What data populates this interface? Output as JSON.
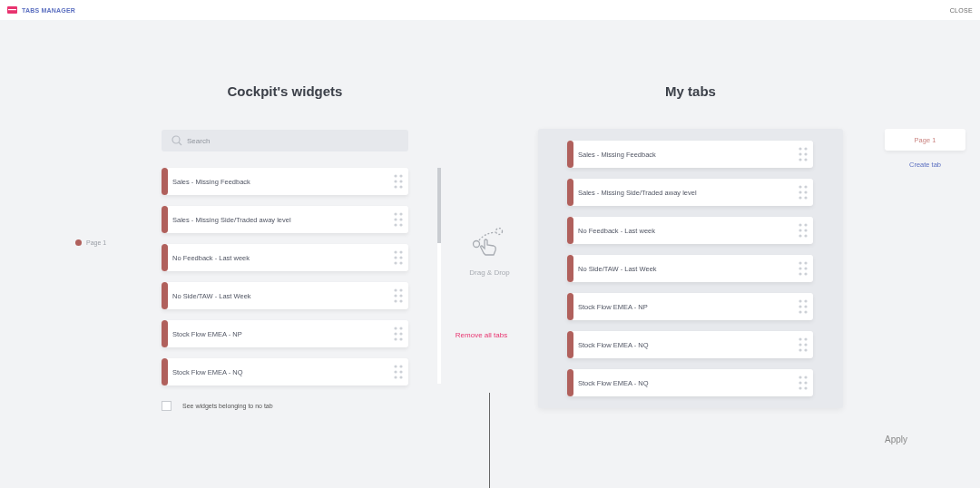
{
  "header": {
    "title": "TABS MANAGER",
    "close": "CLOSE"
  },
  "legend": [
    {
      "label": "Page 1",
      "color": "#b0605c"
    }
  ],
  "widgets": {
    "title": "Cockpit's widgets",
    "search": {
      "placeholder": "Search"
    },
    "items": [
      {
        "name": "Sales - Missing Feedback",
        "color": "#b0605c"
      },
      {
        "name": "Sales - Missing Side/Traded away level",
        "color": "#b0605c"
      },
      {
        "name": "No Feedback - Last week",
        "color": "#b0605c"
      },
      {
        "name": "No Side/TAW - Last Week",
        "color": "#b0605c"
      },
      {
        "name": "Stock Flow EMEA - NP",
        "color": "#b0605c"
      },
      {
        "name": "Stock Flow EMEA - NQ",
        "color": "#b0605c"
      }
    ],
    "no_tab_filter": {
      "label": "See widgets belonging to no tab",
      "checked": false
    }
  },
  "drop_hint": "Drag & Drop",
  "remove_all": "Remove all tabs",
  "my_tabs": {
    "title": "My tabs",
    "items": [
      {
        "name": "Sales - Missing Feedback",
        "color": "#b0605c"
      },
      {
        "name": "Sales - Missing Side/Traded away level",
        "color": "#b0605c"
      },
      {
        "name": "No Feedback - Last week",
        "color": "#b0605c"
      },
      {
        "name": "No Side/TAW - Last Week",
        "color": "#b0605c"
      },
      {
        "name": "Stock Flow EMEA - NP",
        "color": "#b0605c"
      },
      {
        "name": "Stock Flow EMEA - NQ",
        "color": "#b0605c"
      },
      {
        "name": "Stock Flow EMEA - NQ",
        "color": "#b0605c"
      }
    ]
  },
  "pages": [
    {
      "label": "Page 1",
      "selected": true
    }
  ],
  "create_tab": "Create tab",
  "apply": "Apply"
}
